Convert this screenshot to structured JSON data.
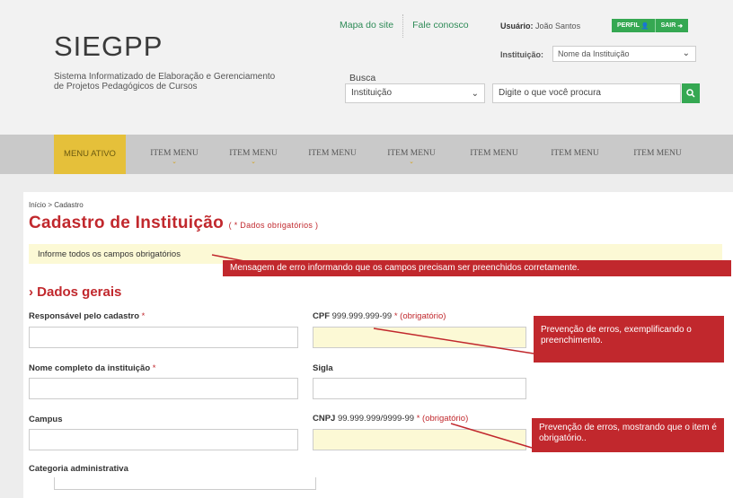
{
  "header": {
    "logo": "SIEGPP",
    "logo_subtitle": "Sistema Informatizado de Elaboração e Gerenciamento de Projetos Pedagógicos de Cursos",
    "links": {
      "site_map": "Mapa do site",
      "contact": "Fale conosco"
    },
    "user": {
      "label": "Usuário:",
      "name": "João Santos"
    },
    "buttons": {
      "profile": "PERFIL",
      "logout": "SAIR"
    },
    "institution": {
      "label": "Instituição:",
      "value": "Nome da Instituição"
    },
    "search": {
      "label": "Busca",
      "select_value": "Instituição",
      "placeholder": "Digite o que você procura"
    }
  },
  "nav": {
    "items": [
      {
        "label": "MENU ATIVO",
        "active": true,
        "has_dropdown": false
      },
      {
        "label": "ITEM MENU",
        "has_dropdown": true
      },
      {
        "label": "ITEM MENU",
        "has_dropdown": true
      },
      {
        "label": "ITEM MENU",
        "has_dropdown": false
      },
      {
        "label": "ITEM MENU",
        "has_dropdown": true
      },
      {
        "label": "ITEM MENU",
        "has_dropdown": false
      },
      {
        "label": "ITEM MENU",
        "has_dropdown": false
      },
      {
        "label": "ITEM MENU",
        "has_dropdown": false
      }
    ]
  },
  "content": {
    "breadcrumb": "Início > Cadastro",
    "title": "Cadastro de Instituição",
    "title_note": "( * Dados obrigatórios )",
    "info_message": "Informe todos os campos obrigatórios",
    "section_title": "› Dados gerais",
    "fields": {
      "responsavel": {
        "label": "Responsável pelo cadastro",
        "req": "*"
      },
      "cpf": {
        "label": "CPF",
        "hint": "999.999.999-99",
        "req": "* (obrigatório)"
      },
      "nome": {
        "label": "Nome completo da instituição",
        "req": "*"
      },
      "sigla": {
        "label": "Sigla"
      },
      "campus": {
        "label": "Campus"
      },
      "cnpj": {
        "label": "CNPJ",
        "hint": "99.999.999/9999-99",
        "req": "* (obrigatório)"
      },
      "categoria": {
        "label": "Categoria administrativa"
      }
    },
    "callouts": {
      "error": "Mensagem de erro informando que os campos precisam ser preenchidos corretamente.",
      "example": "Prevenção de erros,  exemplificando o preenchimento.",
      "required": "Prevenção de erros, mostrando que o item é obrigatório.."
    }
  },
  "colors": {
    "accent_red": "#c1282d",
    "green": "#35a852",
    "active_menu": "#e5c03a",
    "highlight": "#fcf9d5"
  }
}
